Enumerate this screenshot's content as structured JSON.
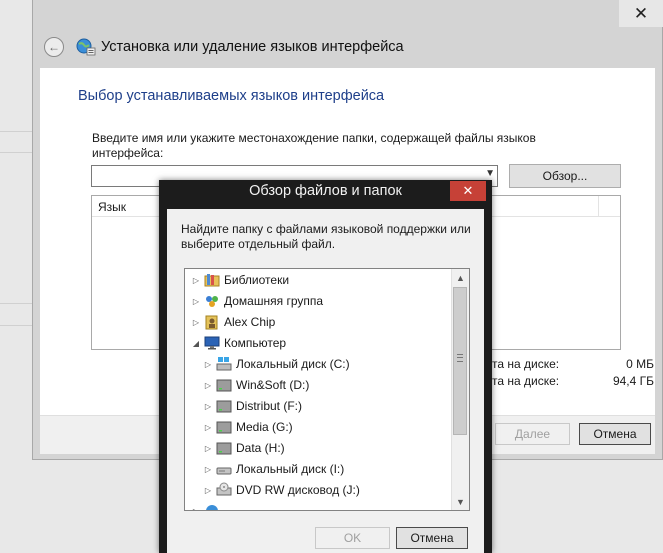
{
  "main_window": {
    "title": "Установка или удаление языков интерфейса",
    "close_glyph": "✕",
    "back_glyph": "←",
    "heading": "Выбор устанавливаемых языков интерфейса",
    "instruction": "Введите имя или укажите местонахождение папки, содержащей файлы языков интерфейса:",
    "path_value": "",
    "browse_label": "Обзор...",
    "table_header": "Язык",
    "disk_stats": [
      {
        "label": "сста на диске:",
        "value": "0 МБ"
      },
      {
        "label": "сста на диске:",
        "value": "94,4 ГБ"
      }
    ],
    "next_label": "Далее",
    "cancel_label": "Отмена"
  },
  "dialog": {
    "title": "Обзор файлов и папок",
    "close_glyph": "✕",
    "description": "Найдите папку с файлами языковой поддержки или выберите отдельный файл.",
    "tree": [
      {
        "label": "Библиотеки",
        "icon": "libraries-icon",
        "level": 0,
        "expanded": false
      },
      {
        "label": "Домашняя группа",
        "icon": "homegroup-icon",
        "level": 0,
        "expanded": false
      },
      {
        "label": "Alex Chip",
        "icon": "user-folder-icon",
        "level": 0,
        "expanded": false
      },
      {
        "label": "Компьютер",
        "icon": "computer-icon",
        "level": 0,
        "expanded": true
      },
      {
        "label": "Локальный диск (C:)",
        "icon": "system-drive-icon",
        "level": 1,
        "expanded": false
      },
      {
        "label": "Win&Soft (D:)",
        "icon": "hard-drive-icon",
        "level": 1,
        "expanded": false
      },
      {
        "label": "Distribut (F:)",
        "icon": "hard-drive-icon",
        "level": 1,
        "expanded": false
      },
      {
        "label": "Media (G:)",
        "icon": "hard-drive-icon",
        "level": 1,
        "expanded": false
      },
      {
        "label": "Data (H:)",
        "icon": "hard-drive-icon",
        "level": 1,
        "expanded": false
      },
      {
        "label": "Локальный диск (I:)",
        "icon": "removable-drive-icon",
        "level": 1,
        "expanded": false
      },
      {
        "label": "DVD RW дисковод (J:)",
        "icon": "dvd-drive-icon",
        "level": 1,
        "expanded": false
      },
      {
        "label": "",
        "icon": "network-icon",
        "level": 0,
        "expanded": false
      }
    ],
    "ok_label": "OK",
    "cancel_label": "Отмена"
  },
  "colors": {
    "heading": "#1e3f8a",
    "dialog_frame": "#1c1c1c",
    "dialog_close": "#c64137"
  }
}
